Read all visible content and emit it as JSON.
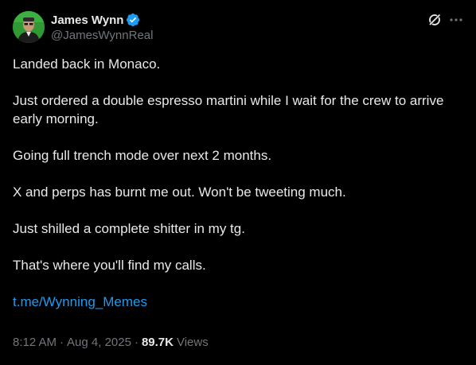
{
  "author": {
    "display_name": "James Wynn",
    "handle": "@JamesWynnReal",
    "verified": true,
    "avatar_icon": "profile-photo",
    "verified_icon": "verified-badge-icon"
  },
  "header_actions": {
    "grok_icon": "grok-icon",
    "more_icon": "more-options-icon"
  },
  "tweet": {
    "paragraphs": [
      "Landed back in Monaco.",
      "Just ordered a double espresso martini while I wait for the crew to arrive early morning.",
      "Going full trench mode over next 2 months.",
      "X and perps has burnt me out. Won't be tweeting much.",
      "Just shilled a complete shitter in my tg.",
      "That's where you'll find my calls."
    ],
    "link": "t.me/Wynning_Memes"
  },
  "meta": {
    "time": "8:12 AM",
    "separator": "·",
    "date": "Aug 4, 2025",
    "separator2": "·",
    "views_count": "89.7K",
    "views_label": "Views"
  },
  "colors": {
    "background": "#000000",
    "text": "#e7e9ea",
    "secondary": "#71767b",
    "link": "#1d9bf0",
    "verified": "#1d9bf0"
  }
}
